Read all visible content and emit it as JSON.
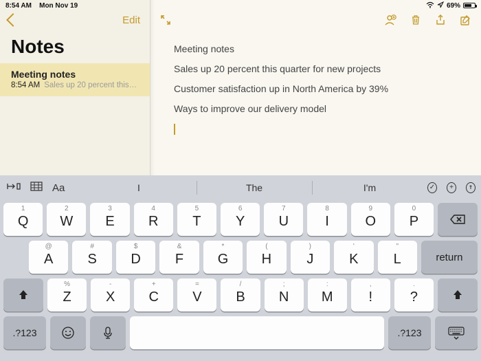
{
  "status_bar": {
    "time": "8:54 AM",
    "date": "Mon Nov 19",
    "battery_pct": "69%"
  },
  "sidebar": {
    "edit_label": "Edit",
    "title": "Notes",
    "items": [
      {
        "title": "Meeting notes",
        "time": "8:54 AM",
        "preview": "Sales up 20 percent this…"
      }
    ]
  },
  "editor": {
    "lines": [
      "Meeting notes",
      "Sales up 20 percent this quarter for new projects",
      "Customer satisfaction up in North America by 39%",
      "Ways to improve our delivery model"
    ]
  },
  "keyboard": {
    "suggestions": [
      "I",
      "The",
      "I'm"
    ],
    "row1_sup": [
      "1",
      "2",
      "3",
      "4",
      "5",
      "6",
      "7",
      "8",
      "9",
      "0"
    ],
    "row1": [
      "Q",
      "W",
      "E",
      "R",
      "T",
      "Y",
      "U",
      "I",
      "O",
      "P"
    ],
    "row2_sup": [
      "@",
      "#",
      "$",
      "&",
      "*",
      "(",
      ")",
      "'",
      "\""
    ],
    "row2": [
      "A",
      "S",
      "D",
      "F",
      "G",
      "H",
      "J",
      "K",
      "L"
    ],
    "row3_sup": [
      "%",
      "-",
      "+",
      "=",
      "/",
      ";",
      ":",
      "!",
      "?"
    ],
    "row3": [
      "Z",
      "X",
      "C",
      "V",
      "B",
      "N",
      "M",
      "!",
      "?"
    ],
    "mode_label": ".?123",
    "return_label": "return"
  },
  "icons": {
    "back": "chevron-left",
    "fullscreen": "expand-arrows",
    "add_person": "person-plus",
    "trash": "trash",
    "share": "share",
    "compose": "compose",
    "tab_key": "tab",
    "table": "table",
    "format": "Aa",
    "check": "check-circle",
    "plus": "plus-circle",
    "pen": "pen-circle",
    "shift": "shift",
    "backspace": "backspace",
    "emoji": "emoji",
    "mic": "mic",
    "hide_kb": "hide-keyboard"
  }
}
